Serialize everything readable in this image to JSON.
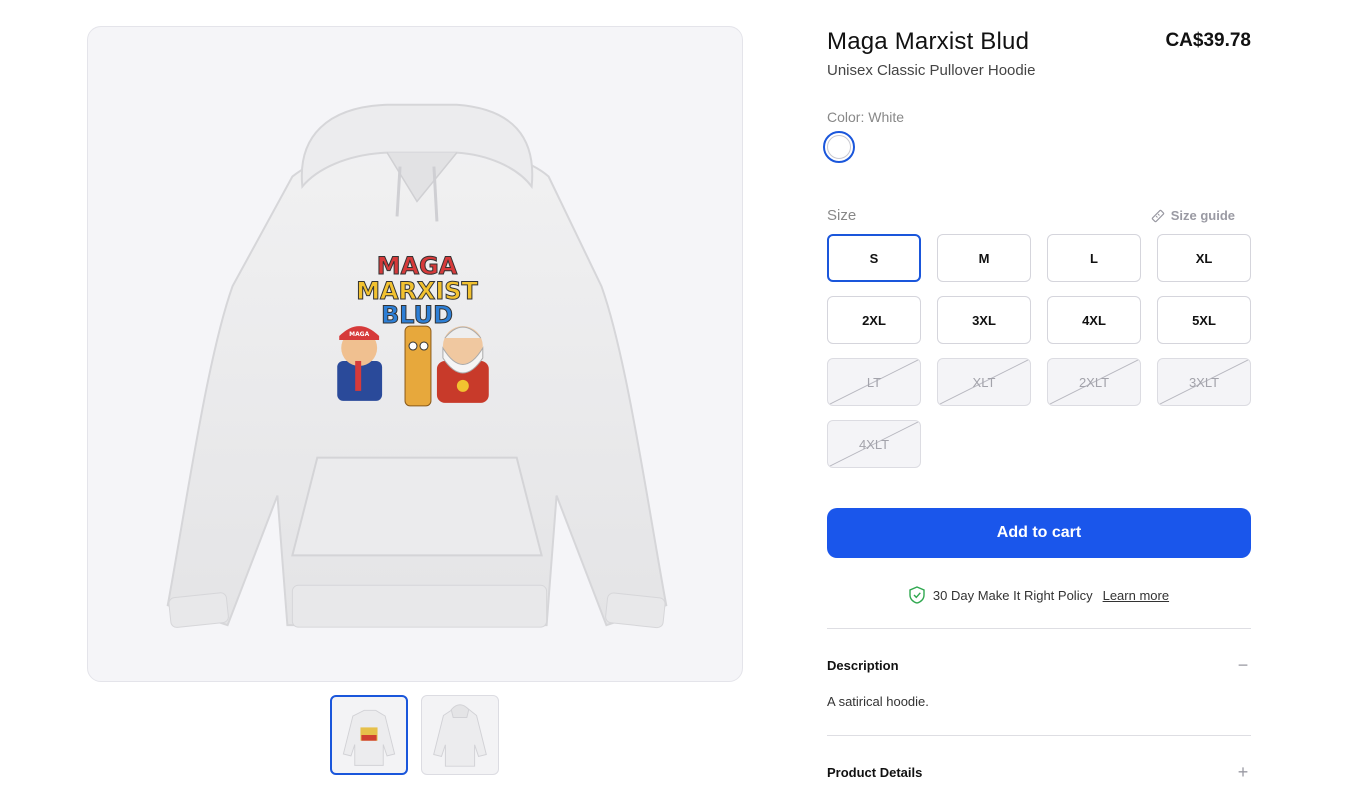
{
  "product": {
    "title": "Maga Marxist Blud",
    "subtitle": "Unisex Classic Pullover Hoodie",
    "price": "CA$39.78"
  },
  "design": {
    "line1": "MAGA",
    "line2": "MARXIST",
    "line3": "BLUD",
    "cap_text": "MAGA"
  },
  "color": {
    "label": "Color: White",
    "selected_hex": "#ffffff"
  },
  "size": {
    "label": "Size",
    "guide_label": "Size guide",
    "options": [
      {
        "label": "S",
        "state": "selected"
      },
      {
        "label": "M",
        "state": "available"
      },
      {
        "label": "L",
        "state": "available"
      },
      {
        "label": "XL",
        "state": "available"
      },
      {
        "label": "2XL",
        "state": "available"
      },
      {
        "label": "3XL",
        "state": "available"
      },
      {
        "label": "4XL",
        "state": "available"
      },
      {
        "label": "5XL",
        "state": "available"
      },
      {
        "label": "LT",
        "state": "unavailable"
      },
      {
        "label": "XLT",
        "state": "unavailable"
      },
      {
        "label": "2XLT",
        "state": "unavailable"
      },
      {
        "label": "3XLT",
        "state": "unavailable"
      },
      {
        "label": "4XLT",
        "state": "unavailable"
      }
    ]
  },
  "cart": {
    "label": "Add to cart"
  },
  "policy": {
    "text": "30 Day Make It Right Policy",
    "link": "Learn more"
  },
  "description": {
    "title": "Description",
    "toggle": "−",
    "body": "A satirical hoodie."
  },
  "product_details": {
    "title": "Product Details",
    "toggle": "+"
  },
  "colors": {
    "accent": "#1a56db",
    "cart_button": "#1a56eb",
    "shield": "#2fa84f"
  }
}
